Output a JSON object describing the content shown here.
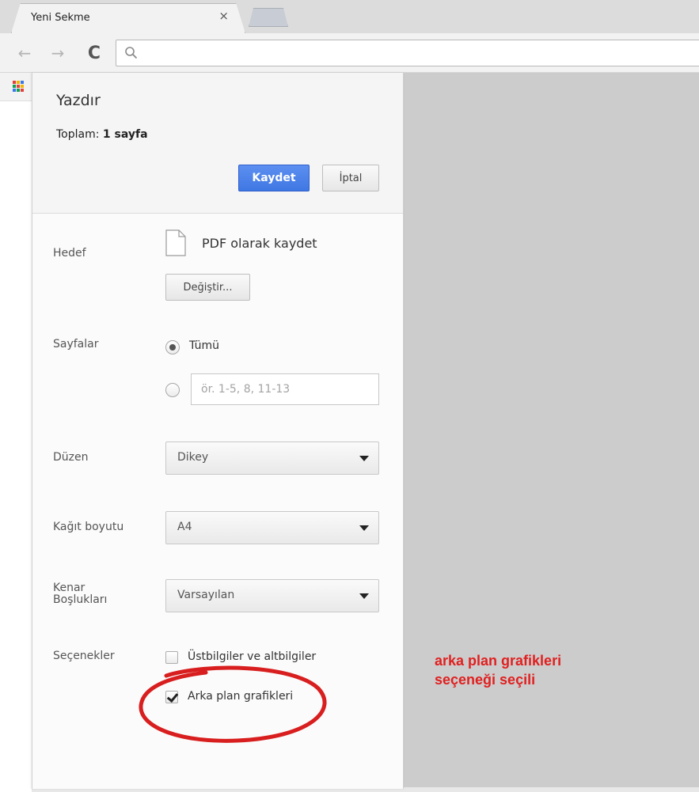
{
  "browser": {
    "tab_title": "Yeni Sekme",
    "tab_close": "×",
    "address": ""
  },
  "print": {
    "title": "Yazdır",
    "summary_label": "Toplam:",
    "summary_value": "1 sayfa",
    "save_button": "Kaydet",
    "cancel_button": "İptal",
    "destination_label": "Hedef",
    "destination_name": "PDF olarak kaydet",
    "change_button": "Değiştir...",
    "pages_label": "Sayfalar",
    "pages_all": "Tümü",
    "pages_range_placeholder": "ör. 1-5, 8, 11-13",
    "layout_label": "Düzen",
    "layout_value": "Dikey",
    "paper_label": "Kağıt boyutu",
    "paper_value": "A4",
    "margins_label_1": "Kenar",
    "margins_label_2": "Boşlukları",
    "margins_value": "Varsayılan",
    "options_label": "Seçenekler",
    "option_headers": "Üstbilgiler ve altbilgiler",
    "option_headers_checked": false,
    "option_background": "Arka plan grafikleri",
    "option_background_checked": true
  },
  "annotation": {
    "line1": "arka plan grafikleri",
    "line2": "seçeneği seçili",
    "color": "#e02020"
  },
  "colors": {
    "primary_button": "#4a82ea",
    "preview_background": "#cccccc"
  }
}
